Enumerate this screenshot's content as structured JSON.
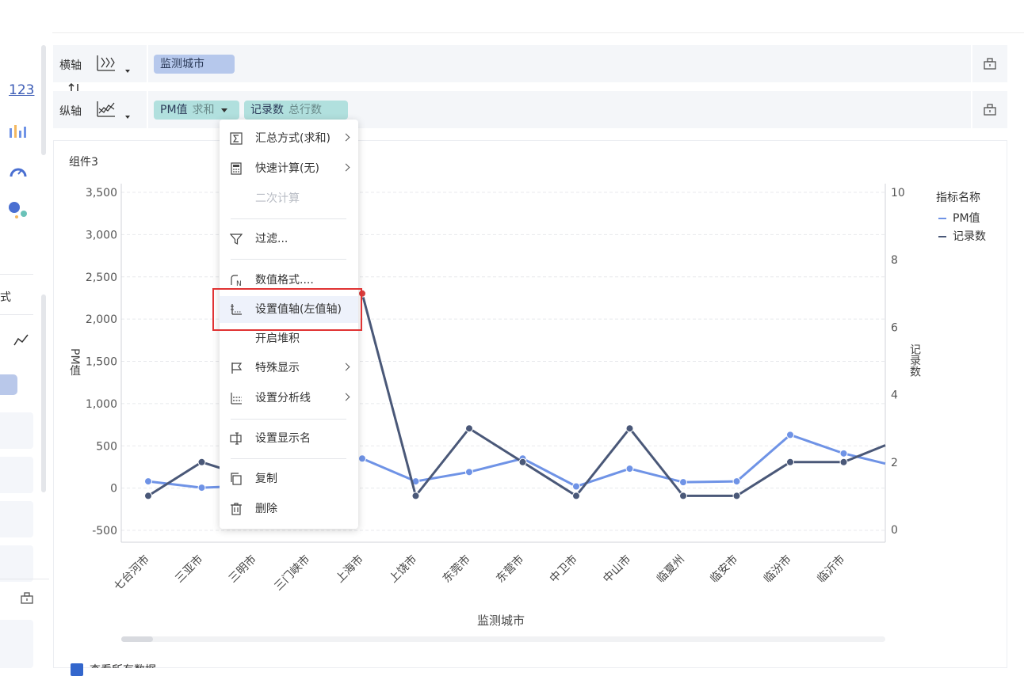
{
  "left_panel": {
    "icon_text_123": "123",
    "partial_text": "式"
  },
  "x_axis_row": {
    "label": "横轴",
    "pill": "监测城市"
  },
  "y_axis_row": {
    "label": "纵轴",
    "pills": [
      {
        "name": "PM值",
        "agg": "求和"
      },
      {
        "name": "记录数",
        "agg": "总行数"
      }
    ]
  },
  "component": {
    "title": "组件3"
  },
  "context_menu": {
    "items": [
      {
        "label": "汇总方式(求和)",
        "icon": "sum-icon",
        "submenu": true
      },
      {
        "label": "快速计算(无)",
        "icon": "calculator-icon",
        "submenu": true
      },
      {
        "label": "二次计算",
        "icon": "",
        "disabled": true
      },
      {
        "label": "过滤...",
        "icon": "filter-icon"
      },
      {
        "label": "数值格式....",
        "icon": "number-format-icon"
      },
      {
        "label": "设置值轴(左值轴)",
        "icon": "value-axis-icon",
        "highlighted": true
      },
      {
        "label": "开启堆积",
        "icon": ""
      },
      {
        "label": "特殊显示",
        "icon": "flag-icon",
        "submenu": true
      },
      {
        "label": "设置分析线",
        "icon": "analysis-line-icon",
        "submenu": true
      },
      {
        "label": "设置显示名",
        "icon": "rename-icon"
      },
      {
        "label": "复制",
        "icon": "copy-icon"
      },
      {
        "label": "删除",
        "icon": "trash-icon"
      }
    ]
  },
  "chart_data": {
    "type": "line",
    "categories": [
      "七台河市",
      "三亚市",
      "三明市",
      "三门峡市",
      "上海市",
      "上饶市",
      "东莞市",
      "东营市",
      "中卫市",
      "中山市",
      "临夏州",
      "临安市",
      "临汾市",
      "临沂市"
    ],
    "xlabel": "监测城市",
    "ylabel": "PM值",
    "y2label": "记录数",
    "ylim": [
      -500,
      3500
    ],
    "y2lim": [
      0,
      10
    ],
    "yticks": [
      "3,500",
      "3,000",
      "2,500",
      "2,000",
      "1,500",
      "1,000",
      "500",
      "0",
      "-500"
    ],
    "y2ticks": [
      "10",
      "8",
      "6",
      "4",
      "2",
      "0"
    ],
    "legend_title": "指标名称",
    "legend_position": "top-right",
    "grid": true,
    "series": [
      {
        "name": "PM值",
        "axis": "left",
        "color": "#6f93e6",
        "values": [
          80,
          5,
          30,
          null,
          350,
          80,
          190,
          350,
          20,
          230,
          70,
          80,
          630,
          410,
          290
        ]
      },
      {
        "name": "记录数",
        "axis": "right",
        "color": "#4a5878",
        "values": [
          1,
          2,
          1.5,
          null,
          7,
          1,
          3,
          2,
          1,
          3,
          1,
          1,
          2,
          2,
          2.5
        ]
      }
    ]
  },
  "bottom": {
    "partial_label": "查看所有数据"
  }
}
